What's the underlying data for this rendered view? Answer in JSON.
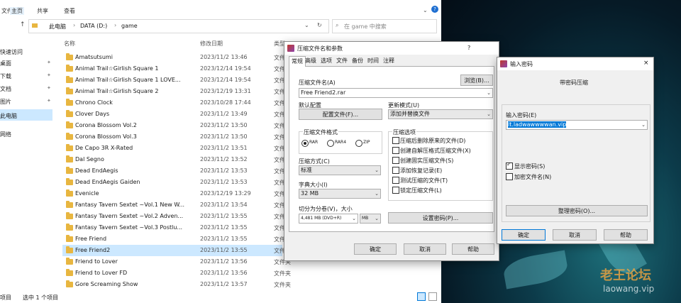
{
  "explorer": {
    "ribbon_tabs": [
      "文件",
      "主页",
      "共享",
      "查看"
    ],
    "breadcrumb": [
      "此电脑",
      "DATA (D:)",
      "game"
    ],
    "search_placeholder": "在 game 中搜索",
    "nav": [
      "快速访问",
      "桌面",
      "下载",
      "文档",
      "图片",
      "此电脑",
      "网络"
    ],
    "columns": {
      "name": "名称",
      "date": "修改日期",
      "type": "类型"
    },
    "rows": [
      {
        "name": "Amatsutsumi",
        "date": "2023/11/2 13:46",
        "type": "文件夹"
      },
      {
        "name": "Animal Trail☆Girlish Square 1",
        "date": "2023/12/14 19:54",
        "type": "文件夹"
      },
      {
        "name": "Animal Trail☆Girlish Square 1 LOVE...",
        "date": "2023/12/14 19:54",
        "type": "文件夹"
      },
      {
        "name": "Animal Trail☆Girlish Square 2",
        "date": "2023/12/19 13:31",
        "type": "文件夹"
      },
      {
        "name": "Chrono Clock",
        "date": "2023/10/28 17:44",
        "type": "文件夹"
      },
      {
        "name": "Clover Days",
        "date": "2023/11/2 13:49",
        "type": "文件夹"
      },
      {
        "name": "Corona Blossom Vol.2",
        "date": "2023/11/2 13:50",
        "type": "文件夹"
      },
      {
        "name": "Corona Blossom Vol.3",
        "date": "2023/11/2 13:50",
        "type": "文件夹"
      },
      {
        "name": "De Capo 3R X-Rated",
        "date": "2023/11/2 13:51",
        "type": "文件夹"
      },
      {
        "name": "Dal Segno",
        "date": "2023/11/2 13:52",
        "type": "文件夹"
      },
      {
        "name": "Dead EndAegis",
        "date": "2023/11/2 13:53",
        "type": "文件夹"
      },
      {
        "name": "Dead EndAegis Gaiden",
        "date": "2023/11/2 13:53",
        "type": "文件夹"
      },
      {
        "name": "Evenicle",
        "date": "2023/12/19 13:29",
        "type": "文件夹"
      },
      {
        "name": "Fantasy Tavern Sextet ~Vol.1 New W...",
        "date": "2023/11/2 13:54",
        "type": "文件夹"
      },
      {
        "name": "Fantasy Tavern Sextet ~Vol.2 Adven...",
        "date": "2023/11/2 13:55",
        "type": "文件夹"
      },
      {
        "name": "Fantasy Tavern Sextet ~Vol.3 Postlu...",
        "date": "2023/11/2 13:55",
        "type": "文件夹"
      },
      {
        "name": "Free Friend",
        "date": "2023/11/2 13:55",
        "type": "文件夹"
      },
      {
        "name": "Free Friend2",
        "date": "2023/11/2 13:55",
        "type": "文件夹"
      },
      {
        "name": "Friend to Lover",
        "date": "2023/11/2 13:56",
        "type": "文件夹"
      },
      {
        "name": "Friend to Lover FD",
        "date": "2023/11/2 13:56",
        "type": "文件夹"
      },
      {
        "name": "Gore Screaming Show",
        "date": "2023/11/2 13:57",
        "type": "文件夹"
      }
    ],
    "selected_index": 17,
    "status": {
      "items": "项目",
      "selected": "选中 1 个项目"
    }
  },
  "archive_dialog": {
    "title": "压缩文件名和参数",
    "tabs": [
      "常规",
      "高级",
      "选项",
      "文件",
      "备份",
      "时间",
      "注释"
    ],
    "active_tab": 0,
    "archive_name_label": "压缩文件名(A)",
    "browse_button": "浏览(B)...",
    "archive_name_value": "Free Friend2.rar",
    "default_profile_label": "默认配置",
    "profiles_button": "配置文件(F)...",
    "update_mode_label": "更新模式(U)",
    "update_mode_value": "添加并替换文件",
    "format_label": "压缩文件格式",
    "formats": [
      "RAR",
      "RAR4",
      "ZIP"
    ],
    "format_selected": 0,
    "method_label": "压缩方式(C)",
    "method_value": "标准",
    "dict_label": "字典大小(I)",
    "dict_value": "32 MB",
    "split_label": "切分为分卷(V)，大小",
    "split_value": "4,481 MB (DVD+R)",
    "split_unit": "MB",
    "options_label": "压缩选项",
    "options": [
      "压缩后删除原来的文件(D)",
      "创建自解压格式压缩文件(X)",
      "创建固实压缩文件(S)",
      "添加恢复记录(E)",
      "测试压缩的文件(T)",
      "锁定压缩文件(L)"
    ],
    "set_password_button": "设置密码(P)...",
    "ok": "确定",
    "cancel": "取消",
    "help": "帮助",
    "help_char": "?"
  },
  "password_dialog": {
    "title": "输入密码",
    "heading": "带密码压缩",
    "enter_label": "输入密码(E)",
    "password_value": "lt.ladwawwwwan.vip",
    "show_password": "显示密码(S)",
    "show_checked": true,
    "encrypt_names": "加密文件名(N)",
    "encrypt_checked": false,
    "organize_button": "整理密码(O)...",
    "ok": "确定",
    "cancel": "取消",
    "help": "帮助"
  },
  "watermark": {
    "line1": "老王论坛",
    "line2": "laowang.vip"
  }
}
